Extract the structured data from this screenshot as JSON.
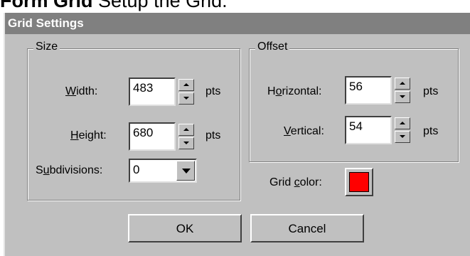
{
  "caption": {
    "bold": "Form Grid",
    "rest": " Setup the Grid."
  },
  "dialog": {
    "title": "Grid Settings",
    "size_group": {
      "label": "Size",
      "width": {
        "label_pre": "",
        "label_u": "W",
        "label_post": "idth:",
        "value": "483",
        "unit": "pts"
      },
      "height": {
        "label_pre": "",
        "label_u": "H",
        "label_post": "eight:",
        "value": "680",
        "unit": "pts"
      },
      "subdivisions": {
        "label_pre": "S",
        "label_u": "u",
        "label_post": "bdivisions:",
        "value": "0"
      }
    },
    "offset_group": {
      "label": "Offset",
      "horizontal": {
        "label_pre": "H",
        "label_u": "o",
        "label_post": "rizontal:",
        "value": "56",
        "unit": "pts"
      },
      "vertical": {
        "label_pre": "",
        "label_u": "V",
        "label_post": "ertical:",
        "value": "54",
        "unit": "pts"
      }
    },
    "grid_color": {
      "label_pre": "Grid ",
      "label_u": "c",
      "label_post": "olor:",
      "color": "#ff0000"
    },
    "ok_label": "OK",
    "cancel_label": "Cancel"
  }
}
